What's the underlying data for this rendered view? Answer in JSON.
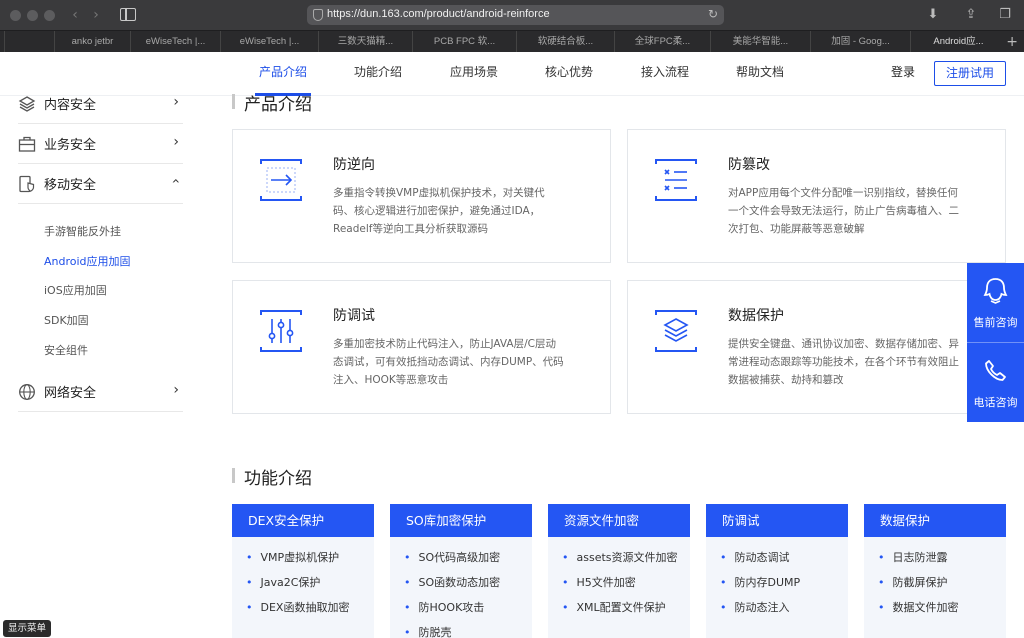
{
  "browser": {
    "url": "https://dun.163.com/product/android-reinforce",
    "tabs": [
      "",
      "anko jetbr",
      "eWiseTech |...",
      "eWiseTech |...",
      "三数天猫精...",
      "PCB FPC 软...",
      "软硬结合板...",
      "全球FPC柔...",
      "美能华智能...",
      "加固 - Goog...",
      "Android应..."
    ]
  },
  "nav": {
    "items": [
      "产品介绍",
      "功能介绍",
      "应用场景",
      "核心优势",
      "接入流程",
      "帮助文档"
    ],
    "active_index": 0,
    "login": "登录",
    "register": "注册试用"
  },
  "menu": {
    "categories": [
      {
        "label": "内容安全",
        "icon": "shield-layers-icon",
        "arrow": "chevron-right-icon"
      },
      {
        "label": "业务安全",
        "icon": "briefcase-icon",
        "arrow": "chevron-right-icon"
      },
      {
        "label": "移动安全",
        "icon": "mobile-shield-icon",
        "arrow": "chevron-up-icon"
      },
      {
        "label": "网络安全",
        "icon": "globe-icon",
        "arrow": "chevron-right-icon"
      }
    ],
    "sub_items": [
      "手游智能反外挂",
      "Android应用加固",
      "iOS应用加固",
      "SDK加固",
      "安全组件"
    ],
    "active_sub": 1
  },
  "product_section": {
    "title": "产品介绍",
    "cards": [
      {
        "title": "防逆向",
        "icon": "reverse-arrow-icon",
        "desc": "多重指令转换VMP虚拟机保护技术，对关键代码、核心逻辑进行加密保护，避免通过IDA，Readelf等逆向工具分析获取源码"
      },
      {
        "title": "防篡改",
        "icon": "checklist-icon",
        "desc": "对APP应用每个文件分配唯一识别指纹，替换任何一个文件会导致无法运行，防止广告病毒植入、二次打包、功能屏蔽等恶意破解"
      },
      {
        "title": "防调试",
        "icon": "sliders-icon",
        "desc": "多重加密技术防止代码注入，防止JAVA层/C层动态调试，可有效抵挡动态调试、内存DUMP、代码注入、HOOK等恶意攻击"
      },
      {
        "title": "数据保护",
        "icon": "layers-icon",
        "desc": "提供安全键盘、通讯协议加密、数据存储加密、异常进程动态跟踪等功能技术，在各个环节有效阻止数据被捕获、劫持和篡改"
      }
    ]
  },
  "function_section": {
    "title": "功能介绍",
    "columns": [
      {
        "header": "DEX安全保护",
        "items": [
          "VMP虚拟机保护",
          "Java2C保护",
          "DEX函数抽取加密"
        ]
      },
      {
        "header": "SO库加密保护",
        "items": [
          "SO代码高级加密",
          "SO函数动态加密",
          "防HOOK攻击",
          "防脱壳"
        ]
      },
      {
        "header": "资源文件加密",
        "items": [
          "assets资源文件加密",
          "H5文件加密",
          "XML配置文件保护"
        ]
      },
      {
        "header": "防调试",
        "items": [
          "防动态调试",
          "防内存DUMP",
          "防动态注入"
        ]
      },
      {
        "header": "数据保护",
        "items": [
          "日志防泄露",
          "防截屏保护",
          "数据文件加密"
        ]
      }
    ]
  },
  "float": {
    "presale": "售前咨询",
    "phone": "电话咨询"
  },
  "footer_hint": "显示菜单",
  "colors": {
    "accent": "#2456f3",
    "nav_active": "#1d4ee8"
  }
}
